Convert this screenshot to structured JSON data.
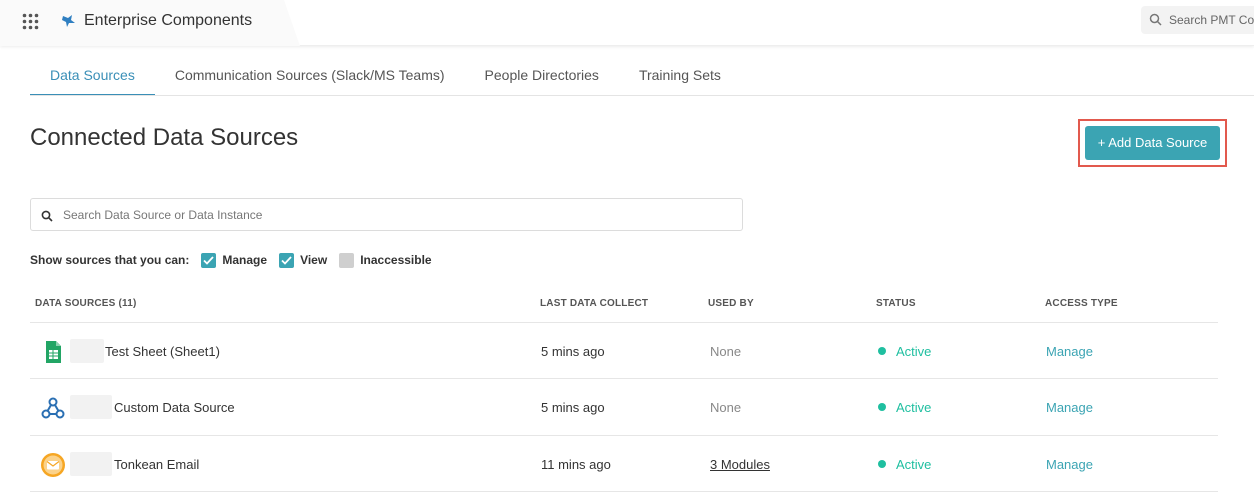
{
  "header": {
    "app_title": "Enterprise Components",
    "search_placeholder": "Search PMT Com",
    "icons": {
      "apps": "grid-apps-icon",
      "brand": "bird-logo-icon",
      "search": "search-icon"
    }
  },
  "tabs": [
    {
      "label": "Data Sources",
      "active": true
    },
    {
      "label": "Communication Sources (Slack/MS Teams)",
      "active": false
    },
    {
      "label": "People Directories",
      "active": false
    },
    {
      "label": "Training Sets",
      "active": false
    }
  ],
  "main": {
    "title": "Connected Data Sources",
    "add_button_label": "+ Add Data Source",
    "search_placeholder": "Search Data Source or Data Instance",
    "filters": {
      "label": "Show sources that you can:",
      "options": [
        {
          "label": "Manage",
          "checked": true
        },
        {
          "label": "View",
          "checked": true
        },
        {
          "label": "Inaccessible",
          "checked": false
        }
      ]
    }
  },
  "table": {
    "headers": {
      "name": "DATA SOURCES (11)",
      "last": "LAST DATA COLLECT",
      "used": "USED BY",
      "status": "STATUS",
      "access": "ACCESS TYPE"
    },
    "rows": [
      {
        "icon": "google-sheets-icon",
        "name": "Test Sheet (Sheet1)",
        "last": "5 mins ago",
        "used": "None",
        "status": "Active",
        "access": "Manage"
      },
      {
        "icon": "webhook-icon",
        "name": "Custom Data Source",
        "last": "5 mins ago",
        "used": "None",
        "status": "Active",
        "access": "Manage"
      },
      {
        "icon": "email-icon",
        "name": "Tonkean Email",
        "last": "11 mins ago",
        "used": "3 Modules",
        "status": "Active",
        "access": "Manage"
      }
    ]
  },
  "colors": {
    "accent": "#3ba4b3",
    "tab_active": "#3a8fb7",
    "status_active": "#1fbfa0",
    "highlight": "#e2594d"
  }
}
